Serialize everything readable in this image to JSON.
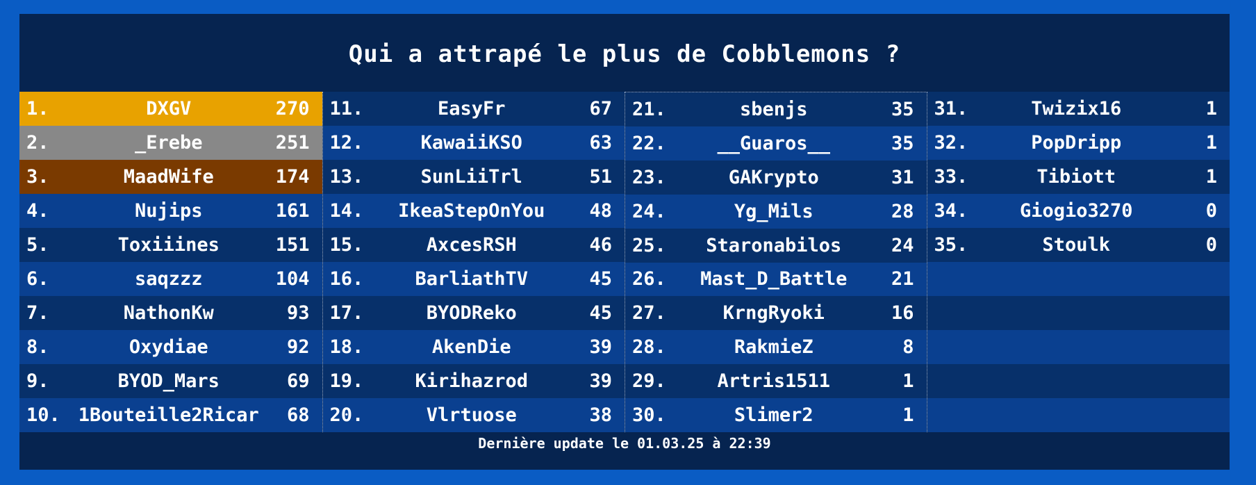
{
  "title": "Qui a attrapé le plus de Cobblemons ?",
  "footer": "Dernière update le 01.03.25 à 22:39",
  "colors": {
    "background": "#0a5cc4",
    "board": "#062450",
    "row_odd": "#0a4090",
    "row_even": "#07306a",
    "gold": "#e8a200",
    "silver": "#888888",
    "bronze": "#7a3a00"
  },
  "leaderboard": [
    {
      "rank": "1.",
      "name": "DXGV",
      "count": "270"
    },
    {
      "rank": "2.",
      "name": "_Erebe",
      "count": "251"
    },
    {
      "rank": "3.",
      "name": "MaadWife",
      "count": "174"
    },
    {
      "rank": "4.",
      "name": "Nujips",
      "count": "161"
    },
    {
      "rank": "5.",
      "name": "Toxiiines",
      "count": "151"
    },
    {
      "rank": "6.",
      "name": "saqzzz",
      "count": "104"
    },
    {
      "rank": "7.",
      "name": "NathonKw",
      "count": "93"
    },
    {
      "rank": "8.",
      "name": "Oxydiae",
      "count": "92"
    },
    {
      "rank": "9.",
      "name": "BYOD_Mars",
      "count": "69"
    },
    {
      "rank": "10.",
      "name": "1Bouteille2Ricar",
      "count": "68"
    },
    {
      "rank": "11.",
      "name": "EasyFr",
      "count": "67"
    },
    {
      "rank": "12.",
      "name": "KawaiiKSO",
      "count": "63"
    },
    {
      "rank": "13.",
      "name": "SunLiiTrl",
      "count": "51"
    },
    {
      "rank": "14.",
      "name": "IkeaStepOnYou",
      "count": "48"
    },
    {
      "rank": "15.",
      "name": "AxcesRSH",
      "count": "46"
    },
    {
      "rank": "16.",
      "name": "BarliathTV",
      "count": "45"
    },
    {
      "rank": "17.",
      "name": "BYODReko",
      "count": "45"
    },
    {
      "rank": "18.",
      "name": "AkenDie",
      "count": "39"
    },
    {
      "rank": "19.",
      "name": "Kirihazrod",
      "count": "39"
    },
    {
      "rank": "20.",
      "name": "Vlrtuose",
      "count": "38"
    },
    {
      "rank": "21.",
      "name": "sbenjs",
      "count": "35"
    },
    {
      "rank": "22.",
      "name": "__Guaros__",
      "count": "35"
    },
    {
      "rank": "23.",
      "name": "GAKrypto",
      "count": "31"
    },
    {
      "rank": "24.",
      "name": "Yg_Mils",
      "count": "28"
    },
    {
      "rank": "25.",
      "name": "Staronabilos",
      "count": "24"
    },
    {
      "rank": "26.",
      "name": "Mast_D_Battle",
      "count": "21"
    },
    {
      "rank": "27.",
      "name": "KrngRyoki",
      "count": "16"
    },
    {
      "rank": "28.",
      "name": "RakmieZ",
      "count": "8"
    },
    {
      "rank": "29.",
      "name": "Artris1511",
      "count": "1"
    },
    {
      "rank": "30.",
      "name": "Slimer2",
      "count": "1"
    },
    {
      "rank": "31.",
      "name": "Twizix16",
      "count": "1"
    },
    {
      "rank": "32.",
      "name": "PopDripp",
      "count": "1"
    },
    {
      "rank": "33.",
      "name": "Tibiott",
      "count": "1"
    },
    {
      "rank": "34.",
      "name": "Giogio3270",
      "count": "0"
    },
    {
      "rank": "35.",
      "name": "Stoulk",
      "count": "0"
    }
  ]
}
